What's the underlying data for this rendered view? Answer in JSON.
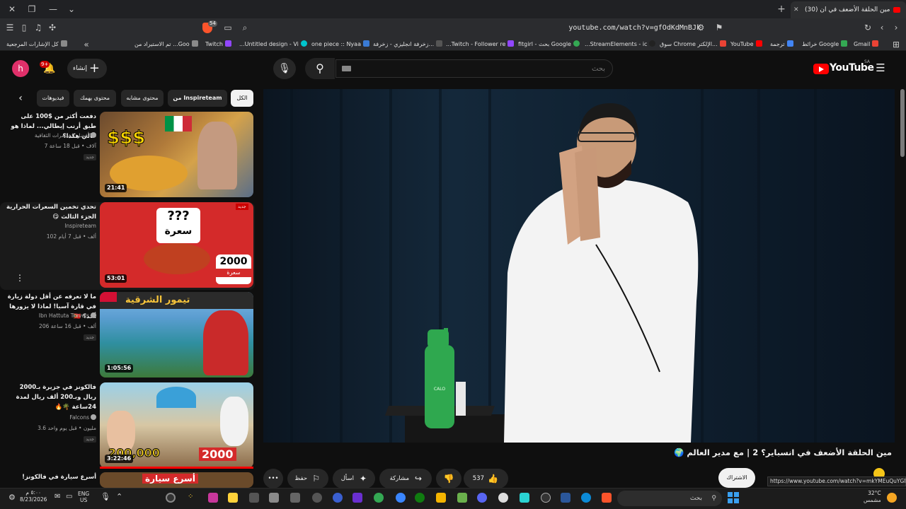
{
  "browser": {
    "tab_title": "(30) مين الحلقة الأضعف في ان",
    "url": "youtube.com/watch?v=gfOdKdMnBJk",
    "brave_badge": "54",
    "bookmarks": [
      {
        "label": "كل الإشارات المرجعية",
        "color": "#8a8a8a"
      },
      {
        "label": "تم الاستيراد من ...Goo",
        "color": "#8a8a8a"
      },
      {
        "label": "Twitch",
        "color": "#9146ff"
      },
      {
        "label": "...Untitled design - Vi",
        "color": "#00c4cc"
      },
      {
        "label": "one piece :: Nyaa",
        "color": "#3a7bd5"
      },
      {
        "label": "زخرفة انجليزي - زخرفة...",
        "color": "#555555"
      },
      {
        "label": "...Twitch - Follower re",
        "color": "#9146ff"
      },
      {
        "label": "fitgirl - بحث Google",
        "color": "#34a853"
      },
      {
        "label": "...StreamElements - ic",
        "color": "#222222"
      },
      {
        "label": "سوق Chrome الإلكتر...",
        "color": "#ea4335"
      },
      {
        "label": "YouTube",
        "color": "#ff0000"
      },
      {
        "label": "ترجمة",
        "color": "#4285f4"
      },
      {
        "label": "خرائط Google",
        "color": "#34a853"
      },
      {
        "label": "Gmail",
        "color": "#ea4335"
      }
    ]
  },
  "youtube": {
    "country": "SA",
    "logo_text": "YouTube",
    "search_placeholder": "بحث",
    "create_label": "إنشاء",
    "notif_count": "9+",
    "avatar_letter": "h",
    "chips": [
      "الكل",
      "من Inspireteam",
      "محتوى مشابه",
      "محتوى يهمك",
      "فيديوهات"
    ],
    "related": [
      {
        "title": "دفعت أكثر من $100 على طبق أرنب إيطالي... لماذا هو غالي هكذا؟",
        "channel": "أفضل المغامرات الثقافية",
        "meta": "7 آلاف • قبل 18 ساعة",
        "badge": "جديد",
        "duration": "21:41"
      },
      {
        "title": "تحدي تخمين السعرات الحرارية الجزء الثالث 😋",
        "channel": "Inspireteam",
        "meta": "102 ألف • قبل 7 أيام",
        "badge": "",
        "duration": "53:01",
        "thumb_badge": "جديد",
        "thumb_text_1": "???",
        "thumb_text_2": "سعرة",
        "thumb_text_3": "2000",
        "thumb_text_4": "سعرة"
      },
      {
        "title": "ما لا تعرفه عن أقل دولة زيارة في قارة آسيا! لماذا لا يزورها أحد؟ 🇹🇱",
        "channel": "Ibn Hattuta Travels",
        "meta": "206 ألف • قبل 16 ساعة",
        "badge": "جديد",
        "duration": "1:05:56",
        "thumb_text_1": "تيمور الشرقية"
      },
      {
        "title": "فالكونز في جزيرة بـ2000 ريال وبـ200 ألف ريال لمدة 24ساعة 🌴🔥",
        "channel": "Falcons",
        "meta": "3.6 مليون • قبل يوم واحد",
        "badge": "جديد",
        "duration": "3:22:46",
        "thumb_text_1": "200,000",
        "thumb_text_2": "2000"
      },
      {
        "title": "أسرع سيارة في فالكونز!",
        "channel": "",
        "meta": "",
        "badge": "",
        "duration": "",
        "thumb_text_1": "أسرع سيارة"
      }
    ],
    "video": {
      "title": "مين الحلقة الأضعف في انسباير؟ 2 | مع مدير العالم 🌍",
      "bottle_text": "CALO",
      "likes": "537",
      "share_label": "مشاركة",
      "ask_label": "اسأل",
      "save_label": "حفظ",
      "subscribe_label": "الاشتراك",
      "status_url": "https://www.youtube.com/watch?v=mkYMEuQuYGM"
    }
  },
  "taskbar": {
    "search_placeholder": "بحث",
    "time": "٥:٠٠ م",
    "date": "8/23/2026",
    "lang_1": "ENG",
    "lang_2": "US",
    "temp": "32°C",
    "weather": "مشمس"
  }
}
